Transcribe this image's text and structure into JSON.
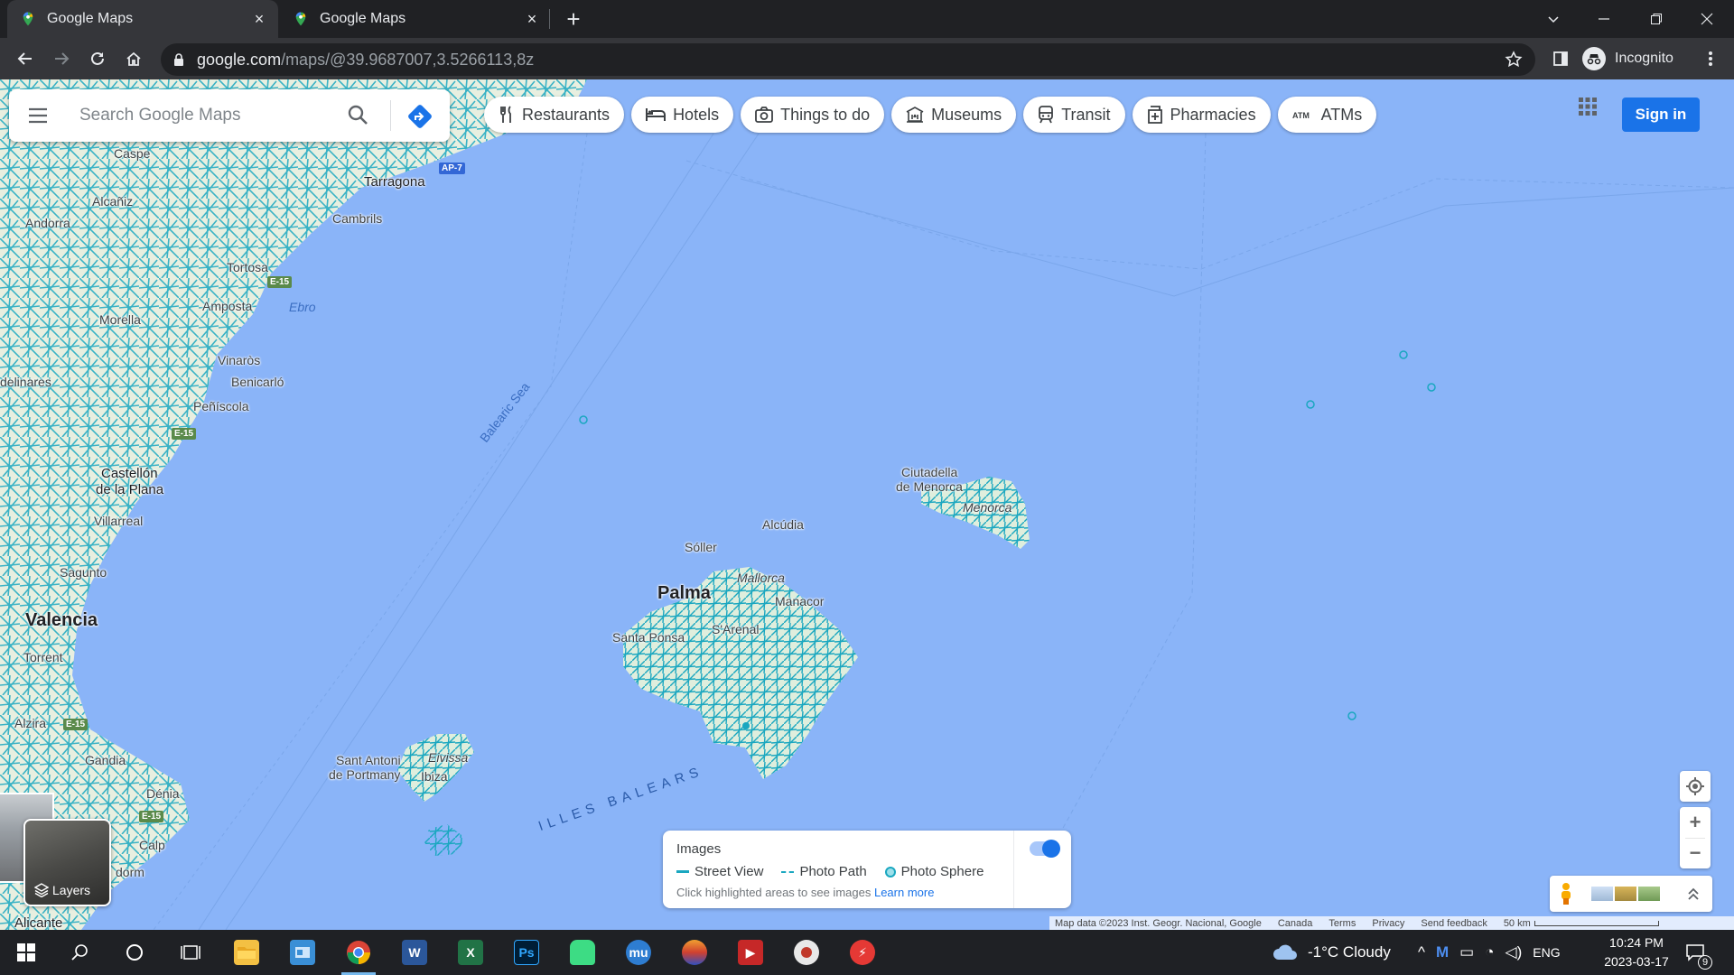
{
  "browser": {
    "tabs": [
      {
        "title": "Google Maps"
      },
      {
        "title": "Google Maps"
      }
    ],
    "url_host": "google.com",
    "url_path": "/maps/@39.9687007,3.5266113,8z",
    "profile_label": "Incognito"
  },
  "maps": {
    "search_placeholder": "Search Google Maps",
    "chips": [
      {
        "label": "Restaurants",
        "icon": "fork-knife-icon"
      },
      {
        "label": "Hotels",
        "icon": "bed-icon"
      },
      {
        "label": "Things to do",
        "icon": "camera-icon"
      },
      {
        "label": "Museums",
        "icon": "museum-icon"
      },
      {
        "label": "Transit",
        "icon": "train-icon"
      },
      {
        "label": "Pharmacies",
        "icon": "pharmacy-icon"
      },
      {
        "label": "ATMs",
        "icon": "atm-icon"
      }
    ],
    "sign_in_label": "Sign in",
    "layers_label": "Layers",
    "places": {
      "caspe": "Caspe",
      "alcaniz": "Alcañiz",
      "andorra": "Andorra",
      "tarragona": "Tarragona",
      "cambrils": "Cambrils",
      "tortosa": "Tortosa",
      "amposta": "Amposta",
      "ebro": "Ebro",
      "morella": "Morella",
      "vinaros": "Vinaròs",
      "benicarlo": "Benicarló",
      "delinares": "delinares",
      "peniscola": "Peñíscola",
      "castellon": "Castellón",
      "delaplana": "de la Plana",
      "villarreal": "Villarreal",
      "sagunto": "Sagunto",
      "valencia": "Valencia",
      "torrent": "Torrent",
      "alzira": "Alzira",
      "gandia": "Gandia",
      "denia": "Dénia",
      "calp": "Calp",
      "dorm": "dorm",
      "alicante": "Alicante",
      "balearic_sea": "Balearic Sea",
      "ciutadella": "Ciutadella",
      "de_menorca": "de Menorca",
      "menorca": "Menorca",
      "alcudia": "Alcúdia",
      "soller": "Sóller",
      "mallorca": "Mallorca",
      "palma": "Palma",
      "manacor": "Manacor",
      "santa_ponsa": "Santa Ponsa",
      "sarenal": "S'Arenal",
      "sant_antoni": "Sant Antoni",
      "de_portmany": "de Portmany",
      "eivissa": "Eivissa",
      "ibiza": "Ibiza",
      "illes_balears": "ILLES BALEARS",
      "ap7": "AP-7",
      "e15": "E-15"
    },
    "legend": {
      "title": "Images",
      "street_view": "Street View",
      "photo_path": "Photo Path",
      "photo_sphere": "Photo Sphere",
      "hint": "Click highlighted areas to see images",
      "learn_more": "Learn more",
      "toggle_on": true
    },
    "attribution": {
      "map_data": "Map data ©2023 Inst. Geogr. Nacional, Google",
      "canada": "Canada",
      "terms": "Terms",
      "privacy": "Privacy",
      "feedback": "Send feedback",
      "scale": "50 km"
    },
    "colors": {
      "water": "#8ab4f8",
      "streetview_lines": "#1ab0c8",
      "land": "#e7f0e0",
      "accent": "#1a73e8"
    }
  },
  "taskbar": {
    "weather": "-1°C  Cloudy",
    "lang": "ENG",
    "time": "10:24 PM",
    "date": "2023-03-17",
    "notifications": "9"
  }
}
